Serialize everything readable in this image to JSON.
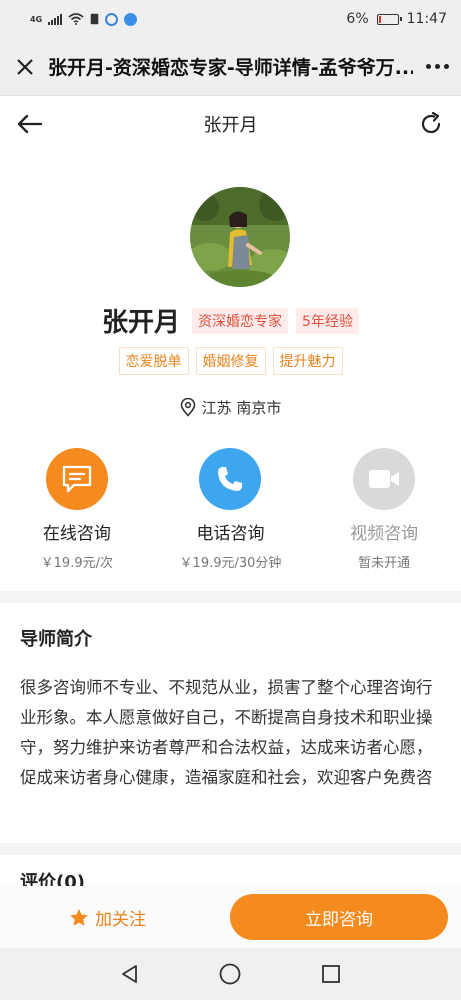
{
  "status_bar": {
    "signal_label": "4G",
    "battery_percent": "6%",
    "battery_level": 0.06,
    "time": "11:47",
    "battery_color": "#e03030"
  },
  "browser": {
    "title": "张开月-资深婚恋专家-导师详情-孟爷爷万...",
    "close_icon": "close-icon",
    "more_icon": "more-dots-icon"
  },
  "nav": {
    "title": "张开月",
    "back_icon": "arrow-left-icon",
    "refresh_icon": "refresh-icon"
  },
  "profile": {
    "name": "张开月",
    "title_tag": "资深婚恋专家",
    "experience_tag": "5年经验",
    "skills": [
      "恋爱脱单",
      "婚姻修复",
      "提升魅力"
    ],
    "location": "江苏 南京市"
  },
  "consult_options": [
    {
      "label": "在线咨询",
      "price": "￥19.9元/次",
      "icon": "chat-icon",
      "color": "#f58a1f",
      "enabled": true
    },
    {
      "label": "电话咨询",
      "price": "￥19.9元/30分钟",
      "icon": "phone-icon",
      "color": "#3ea5ef",
      "enabled": true
    },
    {
      "label": "视频咨询",
      "price": "暂未开通",
      "icon": "video-icon",
      "color": "#d9d9d9",
      "enabled": false
    }
  ],
  "intro": {
    "title": "导师简介",
    "text": "很多咨询师不专业、不规范从业，损害了整个心理咨询行业形象。本人愿意做好自己，不断提高自身技术和职业操守，努力维护来访者尊严和合法权益，达成来访者心愿，促成来访者身心健康，造福家庭和社会，欢迎客户免费咨"
  },
  "reviews": {
    "title": "评价(0)"
  },
  "actions": {
    "follow_label": "加关注",
    "consult_label": "立即咨询",
    "accent_color": "#f58a1f"
  },
  "system_nav": {
    "back_icon": "triangle-back-icon",
    "home_icon": "circle-home-icon",
    "recents_icon": "square-recents-icon"
  }
}
